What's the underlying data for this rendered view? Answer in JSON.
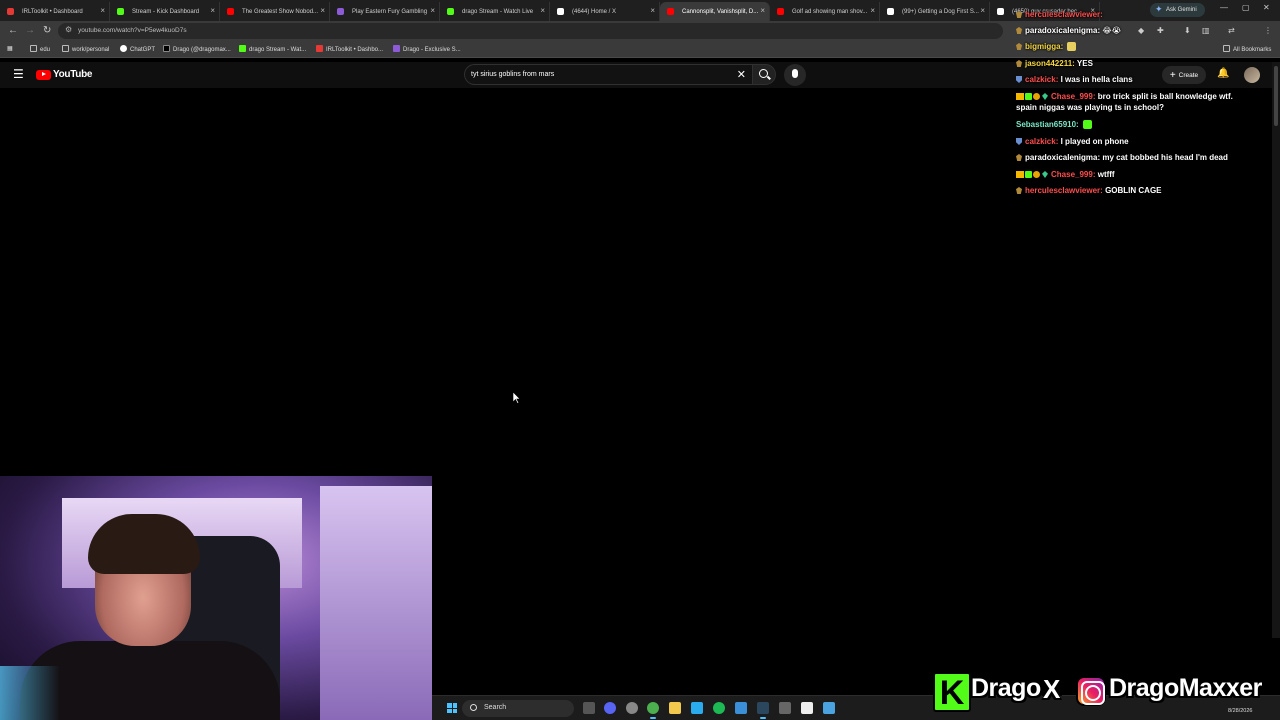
{
  "browser": {
    "tabs": [
      {
        "label": "IRLToolkit • Dashboard",
        "color": "#e53935"
      },
      {
        "label": "Stream - Kick Dashboard",
        "color": "#53fc18"
      },
      {
        "label": "The Greatest Show Nobod...",
        "color": "#ff0000"
      },
      {
        "label": "Play Eastern Fury Gambling",
        "color": "#8e5bd8"
      },
      {
        "label": "drago Stream - Watch Live",
        "color": "#53fc18"
      },
      {
        "label": "(4644) Home / X",
        "color": "#ffffff"
      },
      {
        "label": "Cannonsplit, Vanishsplit, D...",
        "color": "#ff0000",
        "active": true
      },
      {
        "label": "Golf ad showing man shov...",
        "color": "#ff0000"
      },
      {
        "label": "(99+) Getting a Dog First S...",
        "color": "#ffffff"
      },
      {
        "label": "(4650) guy crusader bec...",
        "color": "#ffffff"
      }
    ],
    "ask_gemini": "Ask Gemini",
    "url": "youtube.com/watch?v=P5ew4kuoD7s",
    "bookmarks": [
      {
        "label": "edu",
        "color": "#bbbbbb"
      },
      {
        "label": "work/personal",
        "color": "#bbbbbb"
      },
      {
        "label": "ChatGPT",
        "color": "#ffffff"
      },
      {
        "label": "Drago (@dragomax...",
        "color": "#ffffff"
      },
      {
        "label": "drago Stream - Wat...",
        "color": "#53fc18"
      },
      {
        "label": "IRLToolkit • Dashbo...",
        "color": "#e53935"
      },
      {
        "label": "Drago - Exclusive S...",
        "color": "#8e5bd8"
      }
    ],
    "all_bookmarks": "All Bookmarks"
  },
  "youtube": {
    "logo_text": "YouTube",
    "search_query": "tyt sirius goblins from mars",
    "create_label": "Create"
  },
  "chat": [
    {
      "user": "herculesclawviewer",
      "color": "#ff4d4d",
      "text": ""
    },
    {
      "user": "paradoxicalenigma",
      "color": "#ffffff",
      "text": "😂😭"
    },
    {
      "user": "bigmigga",
      "color": "#f5d742",
      "text": ""
    },
    {
      "user": "jason442211",
      "color": "#f5d742",
      "text": "YES"
    },
    {
      "user": "calzkick",
      "color": "#ff4d4d",
      "text": "I was in hella clans"
    },
    {
      "user": "Chase_999",
      "color": "#ff4d4d",
      "text": "bro trick split is ball knowledge wtf. spain niggas was playing ts in school?"
    },
    {
      "user": "Sebastian65910",
      "color": "#7de8c8",
      "text": ""
    },
    {
      "user": "calzkick",
      "color": "#ff4d4d",
      "text": "I played on phone"
    },
    {
      "user": "paradoxicalenigma",
      "color": "#ffffff",
      "text": "my cat bobbed his head I'm dead"
    },
    {
      "user": "Chase_999",
      "color": "#ff4d4d",
      "text": "wtfff"
    },
    {
      "user": "herculesclawviewer",
      "color": "#ff4d4d",
      "text": "GOBLIN CAGE"
    }
  ],
  "taskbar": {
    "search_label": "Search",
    "date": "8/28/2026"
  },
  "branding": {
    "kick_letter": "K",
    "name1": "Drago",
    "separator": "X",
    "name2": "DragoMaxxer"
  },
  "colors": {
    "kick_green": "#53fc18",
    "youtube_red": "#ff0000"
  }
}
